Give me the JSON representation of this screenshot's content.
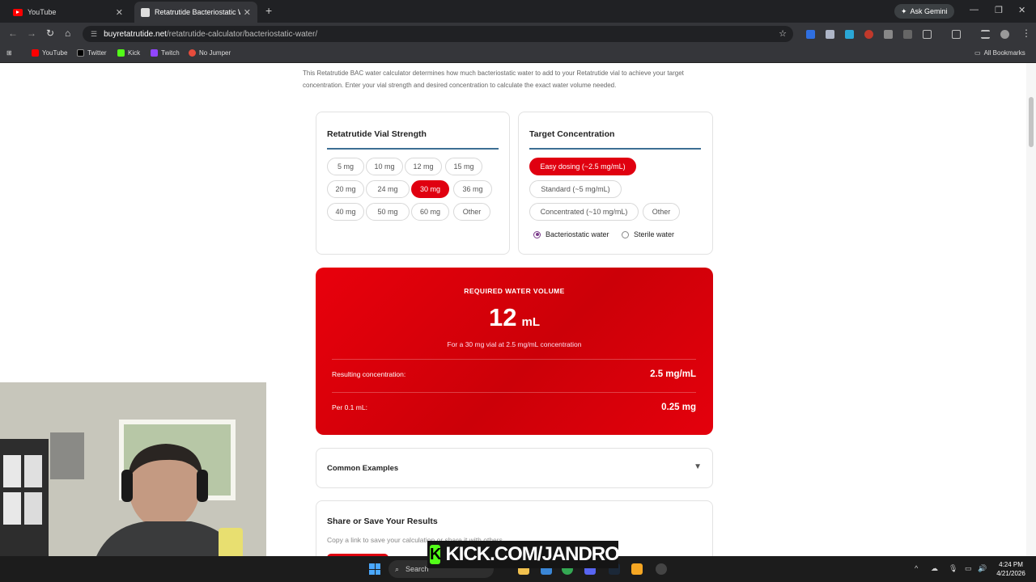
{
  "browser": {
    "tabs": [
      {
        "title": "YouTube",
        "close": "✕"
      },
      {
        "title": "Retatrutide Bacteriostatic Water",
        "close": "✕"
      }
    ],
    "new_tab": "+",
    "ask_gemini": "Ask Gemini",
    "window_controls": {
      "minimize": "—",
      "maximize": "❐",
      "close": "✕"
    },
    "url_domain": "buyretatrutide.net",
    "url_path": "/retatrutide-calculator/bacteriostatic-water/",
    "bookmarks": [
      "YouTube",
      "Twitter",
      "Kick",
      "Twitch",
      "No Jumper"
    ],
    "all_bookmarks": "All Bookmarks"
  },
  "page": {
    "intro": "This Retatrutide BAC water calculator determines how much bacteriostatic water to add to your Retatrutide vial to achieve your target concentration. Enter your vial strength and desired concentration to calculate the exact water volume needed.",
    "vial_card": {
      "title": "Retatrutide Vial Strength",
      "options": [
        "5 mg",
        "10 mg",
        "12 mg",
        "15 mg",
        "20 mg",
        "24 mg",
        "30 mg",
        "36 mg",
        "40 mg",
        "50 mg",
        "60 mg",
        "Other"
      ],
      "selected": "30 mg"
    },
    "target_card": {
      "title": "Target Concentration",
      "options": [
        "Easy dosing (~2.5 mg/mL)",
        "Standard (~5 mg/mL)",
        "Concentrated (~10 mg/mL)",
        "Other"
      ],
      "selected": "Easy dosing (~2.5 mg/mL)",
      "water_types": [
        "Bacteriostatic water",
        "Sterile water"
      ],
      "water_selected": "Bacteriostatic water"
    },
    "result": {
      "label": "REQUIRED WATER VOLUME",
      "value": "12",
      "unit": "mL",
      "description": "For a 30 mg vial at 2.5 mg/mL concentration",
      "rows": [
        {
          "key": "Resulting concentration:",
          "value": "2.5 mg/mL"
        },
        {
          "key": "Per 0.1 mL:",
          "value": "0.25 mg"
        }
      ]
    },
    "examples": {
      "title": "Common Examples",
      "arrow": "▼"
    },
    "share": {
      "title": "Share or Save Your Results",
      "subtitle": "Copy a link to save your calculation or share it with others."
    }
  },
  "taskbar": {
    "search": "Search",
    "time": "4:24 PM",
    "date": "4/21/2026"
  },
  "overlay": {
    "badge": "K",
    "text": "KICK.COM/JANDRO"
  },
  "colors": {
    "accent": "#e00010",
    "divider": "#3d6f94",
    "kick_green": "#53fc18"
  }
}
